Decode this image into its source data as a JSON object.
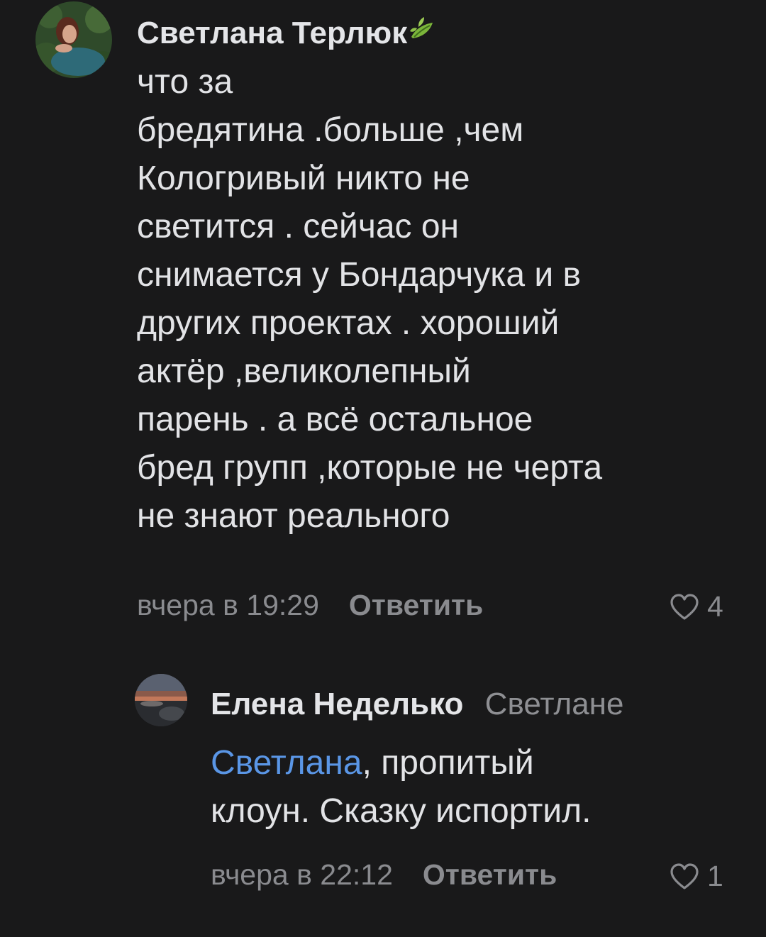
{
  "comments": [
    {
      "author": "Светлана Терлюк",
      "text": "что за\nбредятина .больше ,чем\nКологривый никто не\nсветится . сейчас он\nснимается у Бондарчука и в\nдругих проектах . хороший\nактёр ,великолепный\nпарень . а всё остальное\nбред групп ,которые не черта\nне знают реального",
      "time": "вчера в 19:29",
      "reply_label": "Ответить",
      "likes": "4",
      "badge_icon": "leaf-icon"
    },
    {
      "author": "Елена Неделько",
      "reply_to": "Светлане",
      "mention": "Светлана",
      "text": ", пропитый\nклоун. Сказку испортил.",
      "time": "вчера в 22:12",
      "reply_label": "Ответить",
      "likes": "1"
    }
  ],
  "colors": {
    "background": "#19191a",
    "text": "#e2e3e6",
    "secondary": "#8a8b8f",
    "mention": "#5a96e6"
  }
}
